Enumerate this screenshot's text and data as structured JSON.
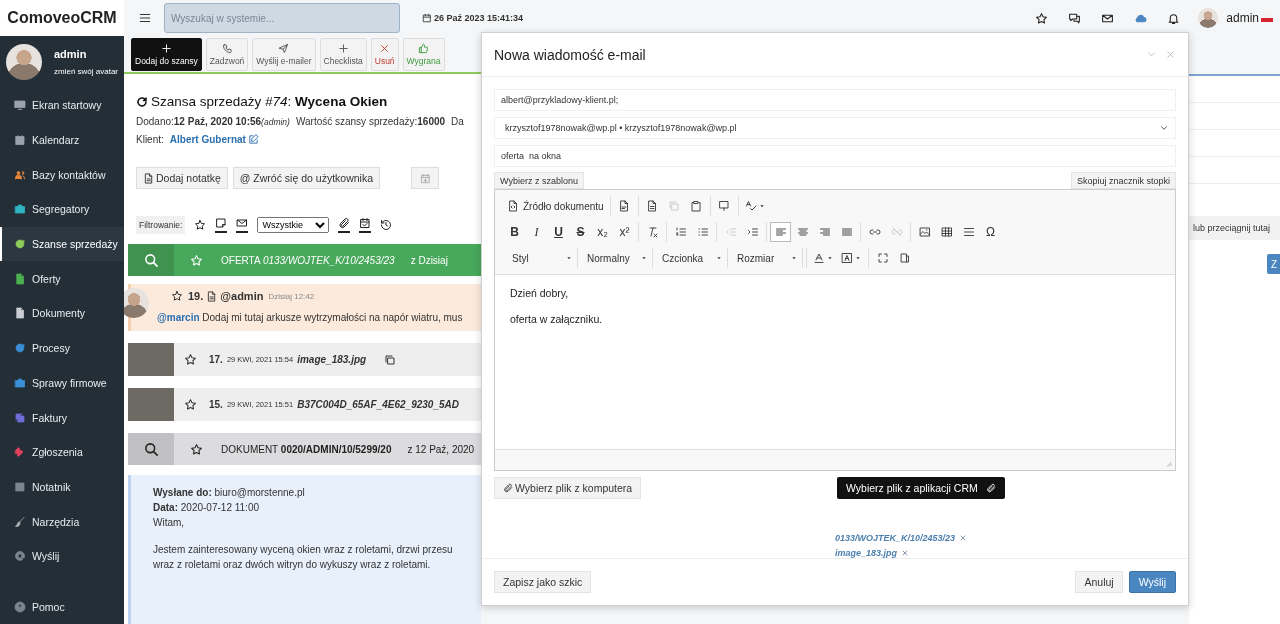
{
  "topbar": {
    "logo": "ComoveoCRM",
    "search_placeholder": "Wyszukaj w systemie...",
    "datetime": "26 Paź 2023 15:41:34",
    "user": "admin"
  },
  "sidebar": {
    "user": {
      "name": "admin",
      "avatar_link": "zmień swój avatar"
    },
    "items": [
      {
        "label": "Ekran startowy",
        "color": "#9aa3ab",
        "selected": false
      },
      {
        "label": "Kalendarz",
        "color": "#9aa3ab",
        "selected": false
      },
      {
        "label": "Bazy kontaktów",
        "color": "#e8873a",
        "selected": false
      },
      {
        "label": "Segregatory",
        "color": "#2fb5c0",
        "selected": false
      },
      {
        "label": "Szanse sprzedaży",
        "color": "#8fcb5a",
        "selected": true
      },
      {
        "label": "Oferty",
        "color": "#4caf50",
        "selected": false
      },
      {
        "label": "Dokumenty",
        "color": "#c9ced3",
        "selected": false
      },
      {
        "label": "Procesy",
        "color": "#3a8fd6",
        "selected": false
      },
      {
        "label": "Sprawy firmowe",
        "color": "#3a8fd6",
        "selected": false
      },
      {
        "label": "Faktury",
        "color": "#6f6fd8",
        "selected": false
      },
      {
        "label": "Zgłoszenia",
        "color": "#e0415c",
        "selected": false
      },
      {
        "label": "Notatnik",
        "color": "#7b858e",
        "selected": false
      },
      {
        "label": "Narzędzia",
        "color": "#b0b6bb",
        "selected": false
      },
      {
        "label": "Wyślij",
        "color": "#7b858e",
        "selected": false
      }
    ],
    "footer_item": {
      "label": "Pomoc",
      "color": "#7b858e",
      "selected": false
    }
  },
  "toolbar": [
    {
      "label": "Dodaj do szansy",
      "kind": "primary"
    },
    {
      "label": "Zadzwoń",
      "kind": "default"
    },
    {
      "label": "Wyślij e-mailer",
      "kind": "default"
    },
    {
      "label": "Checklista",
      "kind": "default"
    },
    {
      "label": "Usuń",
      "kind": "danger"
    },
    {
      "label": "Wygrana",
      "kind": "success"
    }
  ],
  "opportunity": {
    "title": "Szansa sprzedaży *#74*: **Wycena Okien**",
    "meta": [
      {
        "label": "Dodano:",
        "value": "12 Paź, 2020 10:56",
        "note": "(admin)"
      },
      {
        "label": "Wartość szansy sprzedaży:",
        "value": "16000"
      },
      {
        "label": "Da"
      }
    ],
    "client_label": "Klient:",
    "client": "Albert Gubernat",
    "actions": [
      "Dodaj notatkę",
      "@ Zwróć się do użytkownika"
    ],
    "filter": {
      "label": "Filtrowanie:",
      "select": "Wszystkie"
    }
  },
  "feed": [
    {
      "kind": "offer",
      "text": "OFERTA *0133/WOJTEK_K/10/2453/23*",
      "date": "z Dzisiaj"
    },
    {
      "kind": "note",
      "number": "19.",
      "author": "@admin",
      "time": "Dzisiaj 12:42",
      "mention": "@marcin",
      "text": "Dodaj mi tutaj arkusze wytrzymałości na napór wiatru, mus"
    },
    {
      "kind": "file",
      "number": "17.",
      "date": "29 KWI, 2021 15:54",
      "name": "image_183.jpg"
    },
    {
      "kind": "file",
      "number": "15.",
      "date": "29 KWI, 2021 15:51",
      "name": "B37C004D_65AF_4E62_9230_5AD"
    },
    {
      "kind": "document",
      "text": "DOKUMENT **0020/ADMIN/10/5299/20**",
      "date": "z 12 Paź, 2020"
    }
  ],
  "email": {
    "lines": [
      "**Wysłane do:** biuro@morstenne.pl",
      "**Data:** 2020-07-12 11:00",
      "Witam,"
    ],
    "body": [
      "Jestem zainteresowany wyceną okien wraz z roletami, drzwi przesu",
      "wraz z roletami oraz dwóch witryn do wykuszy wraz z roletami."
    ]
  },
  "modal": {
    "title": "Nowa wiadomość e-mail",
    "to": "albert@przykladowy-klient.pl;",
    "from": "krzysztof1978nowak@wp.pl • krzysztof1978nowak@wp.pl",
    "subject": "oferta  na okna",
    "template_button": "Wybierz z szablonu",
    "footer_tag_button": "Skopiuj znacznik stopki",
    "row1": [
      [
        {
          "label": "Źródło dokumentu",
          "disabled": false
        }
      ],
      [
        {
          "disabled": false
        }
      ],
      [
        {
          "disabled": false
        },
        {
          "disabled": true
        },
        {
          "disabled": false
        }
      ],
      [
        {
          "disabled": false
        }
      ],
      [
        {
          "disabled": false
        }
      ]
    ],
    "row2": [
      [
        {
          "label": "B",
          "kind": "bold",
          "selected": false,
          "disabled": false
        },
        {
          "label": "I",
          "kind": "italic",
          "selected": false,
          "disabled": false
        },
        {
          "label": "U",
          "kind": "underline",
          "selected": false,
          "disabled": false
        },
        {
          "label": "S",
          "kind": "strike",
          "selected": false,
          "disabled": false
        },
        {
          "label": "x₂",
          "kind": "plain",
          "selected": false,
          "disabled": false
        },
        {
          "label": "x²",
          "kind": "plain",
          "selected": false,
          "disabled": false
        }
      ],
      [
        {
          "selected": false,
          "disabled": false
        }
      ],
      [
        {
          "selected": false,
          "disabled": false
        },
        {
          "selected": false,
          "disabled": false
        }
      ],
      [
        {
          "selected": false,
          "disabled": true
        },
        {
          "selected": false,
          "disabled": false
        }
      ],
      [
        {
          "selected": true,
          "disabled": false
        },
        {
          "selected": false,
          "disabled": false
        },
        {
          "selected": false,
          "disabled": false
        },
        {
          "selected": false,
          "disabled": false
        }
      ],
      [
        {
          "selected": false,
          "disabled": false
        },
        {
          "selected": false,
          "disabled": true
        }
      ],
      [
        {
          "selected": false,
          "disabled": false
        },
        {
          "selected": false,
          "disabled": false
        },
        {
          "selected": false,
          "disabled": false
        },
        {
          "label": "Ω",
          "kind": "plain",
          "selected": false,
          "disabled": false
        }
      ]
    ],
    "combos": [
      "Styl",
      "Normalny",
      "Czcionka",
      "Rozmiar"
    ],
    "body": [
      "Dzień dobry,",
      "oferta w załączniku."
    ],
    "file_button": "Wybierz plik z komputera",
    "crm_button": "Wybierz plik z aplikacji CRM",
    "attachments": [
      "0133/WOJTEK_K/10/2453/23",
      "image_183.jpg"
    ],
    "draft_button": "Zapisz jako szkic",
    "cancel_button": "Anuluj",
    "send_button": "Wyślij"
  },
  "right_panel": {
    "drop_text": "lub  przeciągnij tutaj",
    "button": "Z"
  }
}
